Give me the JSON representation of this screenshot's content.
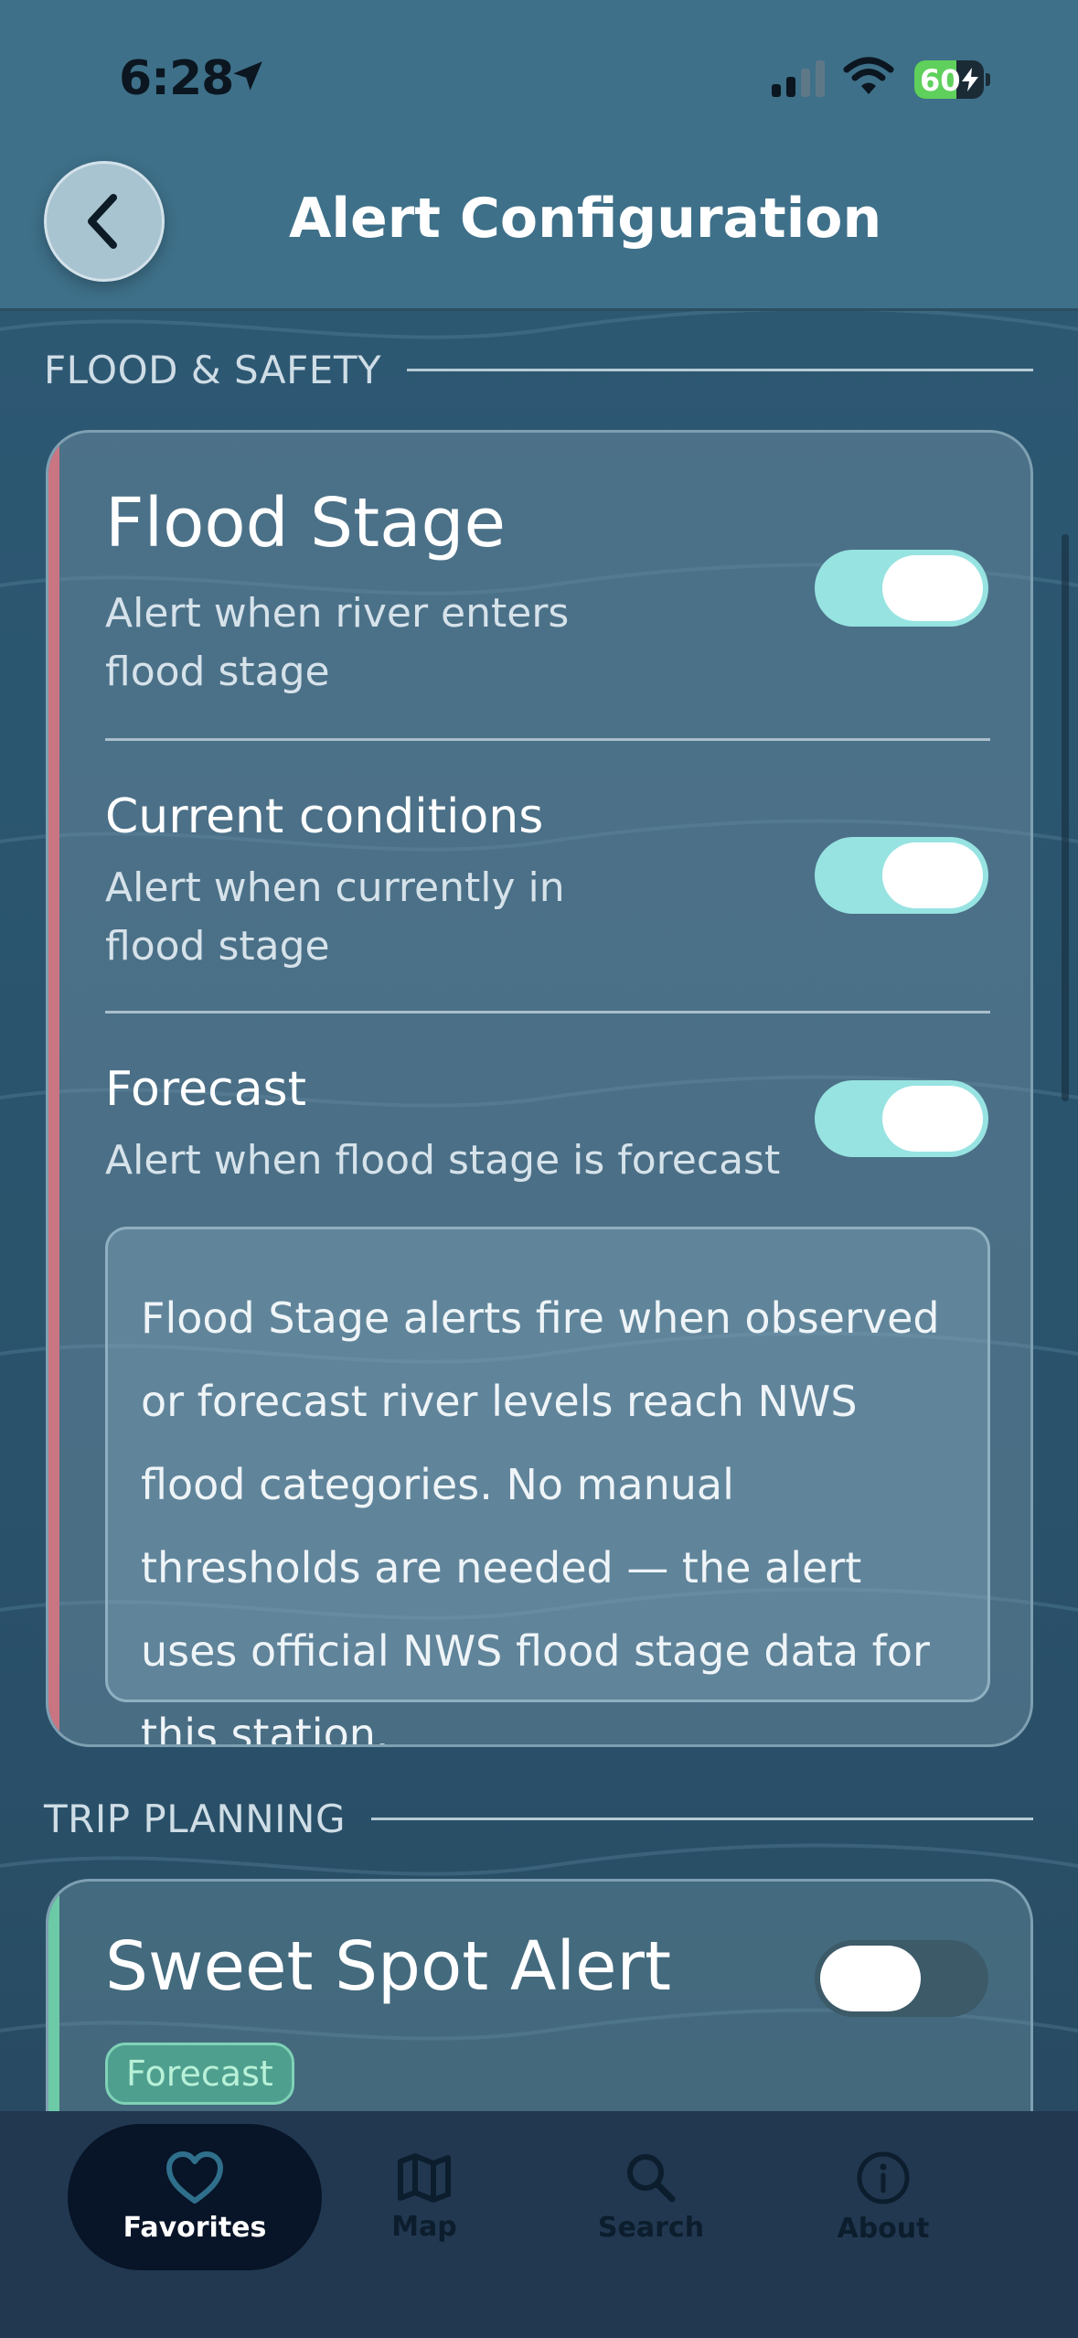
{
  "status_bar": {
    "time": "6:28",
    "battery_level": "60",
    "battery_fraction": 0.6,
    "icons": [
      "location-arrow-icon",
      "cellular-signal-icon",
      "wifi-icon",
      "battery-charging-icon"
    ]
  },
  "header": {
    "title": "Alert Configuration",
    "back_icon": "chevron-left-icon"
  },
  "sections": {
    "flood_safety": {
      "label": "FLOOD & SAFETY",
      "accent_color": "#c97682",
      "rows": [
        {
          "title": "Flood Stage",
          "description": "Alert when river enters flood stage",
          "enabled": true
        },
        {
          "title": "Current conditions",
          "description": "Alert when currently in flood stage",
          "enabled": true
        },
        {
          "title": "Forecast",
          "description": "Alert when flood stage is forecast",
          "enabled": true
        }
      ],
      "info_text": "Flood Stage alerts fire when observed or forecast river levels reach NWS flood categories. No manual thresholds are needed — the alert uses official NWS flood stage data for this station."
    },
    "trip_planning": {
      "label": "TRIP PLANNING",
      "accent_color": "#6ccaa6",
      "rows": [
        {
          "title": "Sweet Spot Alert",
          "badge": "Forecast",
          "enabled": false
        }
      ]
    }
  },
  "tab_bar": {
    "active": "Favorites",
    "tabs": [
      {
        "label": "Favorites",
        "icon": "heart-icon"
      },
      {
        "label": "Map",
        "icon": "map-icon"
      },
      {
        "label": "Search",
        "icon": "search-icon"
      },
      {
        "label": "About",
        "icon": "info-icon"
      }
    ]
  },
  "colors": {
    "toggle_on": "#97e3e2",
    "toggle_off": "#3d5a68",
    "tab_active_bg": "#081427",
    "header_bg": "#3e7089"
  }
}
